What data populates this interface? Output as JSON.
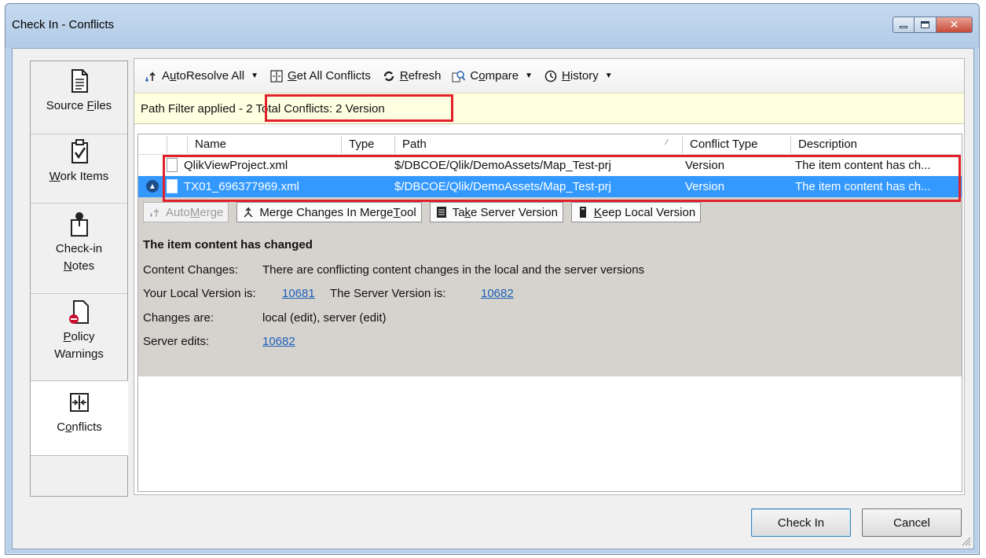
{
  "window": {
    "title": "Check In - Conflicts"
  },
  "nav": [
    {
      "label_pre": "Source ",
      "label_u": "F",
      "label_post": "iles",
      "icon": "document-icon"
    },
    {
      "label_pre": "",
      "label_u": "W",
      "label_post": "ork Items",
      "icon": "clipboard-check-icon"
    },
    {
      "line1": "Check-in",
      "label_pre": "",
      "label_u": "N",
      "label_post": "otes",
      "icon": "notes-pin-icon"
    },
    {
      "label_pre": "",
      "label_u": "P",
      "label_post": "olicy",
      "line2": "Warnings",
      "icon": "policy-warning-icon"
    },
    {
      "label_pre": "C",
      "label_u": "o",
      "label_post": "nflicts",
      "icon": "conflicts-icon"
    }
  ],
  "toolbar": {
    "autoresolve_pre": "A",
    "autoresolve_u": "u",
    "autoresolve_post": "toResolve All",
    "getall_u": "G",
    "getall_post": "et All Conflicts",
    "refresh_u": "R",
    "refresh_post": "efresh",
    "compare_pre": "C",
    "compare_u": "o",
    "compare_post": "mpare",
    "history_u": "H",
    "history_post": "istory"
  },
  "info": {
    "prefix": "Path Filter applied - ",
    "count": "2 Total Conflicts: 2 Version"
  },
  "grid": {
    "columns": [
      "Name",
      "Type",
      "Path",
      "Conflict Type",
      "Description"
    ],
    "rows": [
      {
        "name": "QlikViewProject.xml",
        "type": "",
        "path": "$/DBCOE/Qlik/DemoAssets/Map_Test-prj",
        "conflict_type": "Version",
        "description": "The item content has ch..."
      },
      {
        "name": "TX01_696377969.xml",
        "type": "",
        "path": "$/DBCOE/Qlik/DemoAssets/Map_Test-prj",
        "conflict_type": "Version",
        "description": "The item content has ch..."
      }
    ]
  },
  "detail": {
    "buttons": {
      "automerge_pre": "Auto",
      "automerge_u": "M",
      "automerge_post": "erge",
      "mergetool_pre": "Merge Changes In Merge ",
      "mergetool_u": "T",
      "mergetool_post": "ool",
      "server_pre": "Ta",
      "server_u": "k",
      "server_post": "e Server Version",
      "local_u": "K",
      "local_post": "eep Local Version"
    },
    "title": "The item content has changed",
    "content_label": "Content Changes:",
    "content_value": "There are conflicting content changes in the local and the server versions",
    "local_label": "Your Local Version is:",
    "local_version": "10681",
    "server_label": "The Server Version is:",
    "server_version": "10682",
    "changes_label": "Changes are:",
    "changes_value": "local (edit), server (edit)",
    "edits_label": "Server edits:",
    "edits_value": "10682"
  },
  "footer": {
    "checkin": "Check In",
    "cancel": "Cancel"
  },
  "colors": {
    "selection": "#3399ff",
    "highlight": "#e0202a",
    "info_bg": "#ffffe1",
    "detail_bg": "#d6d3ce"
  }
}
